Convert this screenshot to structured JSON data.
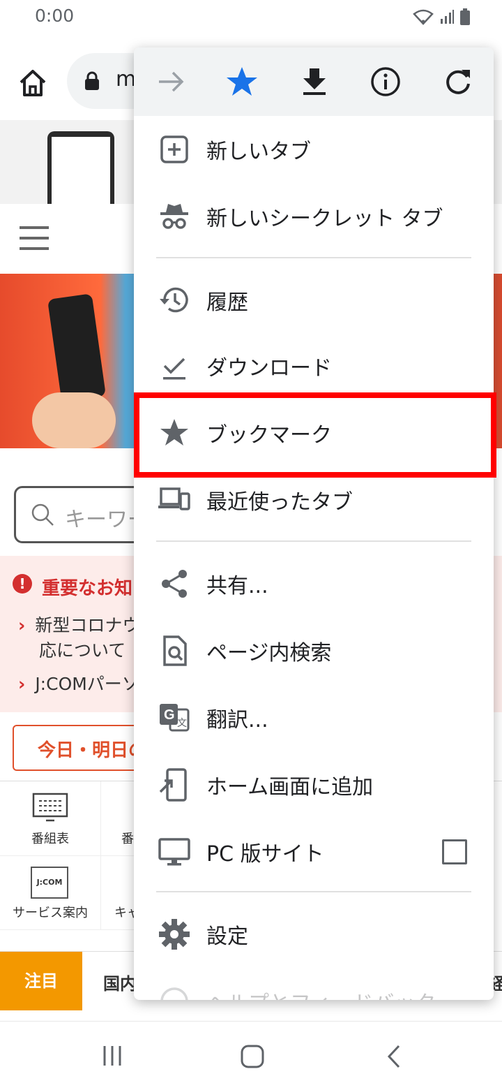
{
  "status_bar": {
    "time": "0:00"
  },
  "browser": {
    "url_fragment": "m"
  },
  "page": {
    "search_placeholder": "キーワー",
    "notice_title": "重要なお知",
    "notice_items": [
      "新型コロナウ",
      "応について",
      "J:COMパーソ"
    ],
    "today_button": "今日・明日の",
    "grid": [
      {
        "label": "番組表",
        "icon": "tv-guide-icon"
      },
      {
        "label": "番",
        "icon": "program-icon"
      },
      {
        "label": "サービス案内",
        "icon": "jcom-door-icon",
        "logo": "J:COM"
      },
      {
        "label": "キャ",
        "icon": "campaign-icon"
      }
    ],
    "tabs": {
      "attention": "注目",
      "domestic": "国内"
    },
    "right_edge_tab": "経"
  },
  "menu": {
    "toolbar_icons": [
      "forward-icon",
      "bookmark-star-icon",
      "download-icon",
      "info-icon",
      "reload-icon"
    ],
    "items": [
      {
        "id": "new-tab",
        "label": "新しいタブ",
        "icon": "new-tab-icon"
      },
      {
        "id": "incognito",
        "label": "新しいシークレット タブ",
        "icon": "incognito-icon"
      },
      {
        "id": "history",
        "label": "履歴",
        "icon": "history-icon"
      },
      {
        "id": "downloads",
        "label": "ダウンロード",
        "icon": "download-check-icon"
      },
      {
        "id": "bookmarks",
        "label": "ブックマーク",
        "icon": "star-icon"
      },
      {
        "id": "recent-tabs",
        "label": "最近使ったタブ",
        "icon": "devices-icon"
      },
      {
        "id": "share",
        "label": "共有...",
        "icon": "share-icon"
      },
      {
        "id": "find",
        "label": "ページ内検索",
        "icon": "find-in-page-icon"
      },
      {
        "id": "translate",
        "label": "翻訳...",
        "icon": "translate-icon"
      },
      {
        "id": "add-home",
        "label": "ホーム画面に追加",
        "icon": "add-to-home-icon"
      },
      {
        "id": "desktop",
        "label": "PC 版サイト",
        "icon": "desktop-icon",
        "checked": false
      },
      {
        "id": "settings",
        "label": "設定",
        "icon": "settings-icon"
      },
      {
        "id": "help",
        "label": "ヘルプとフィードバック",
        "icon": "help-icon"
      }
    ]
  },
  "colors": {
    "accent_blue": "#1a73e8",
    "highlight_red": "#ff0000",
    "icon_gray": "#5f6368"
  }
}
